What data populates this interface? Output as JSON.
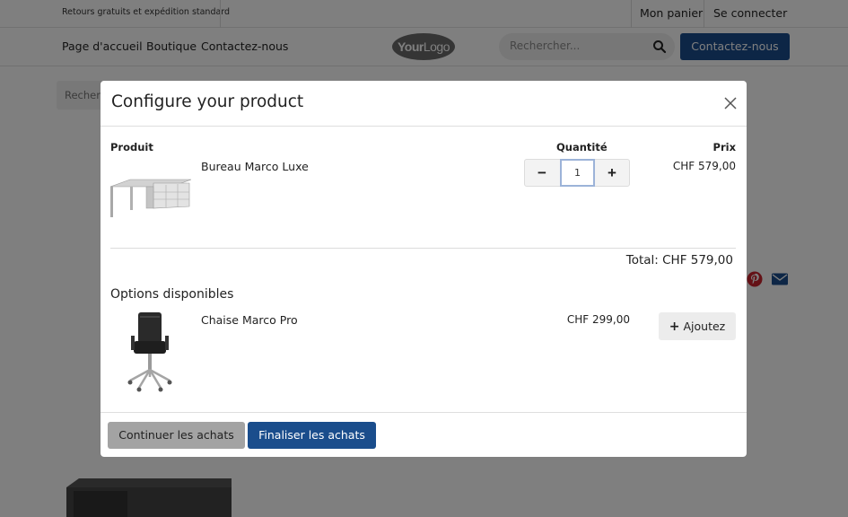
{
  "topbar": {
    "promo": "Retours gratuits et expédition standard",
    "cart": "Mon panier",
    "login": "Se connecter"
  },
  "nav": {
    "items": [
      "Page d'accueil",
      "Boutique",
      "Contactez-nous"
    ],
    "logo": {
      "bold": "Your",
      "light": "Logo"
    },
    "search_placeholder": "Rechercher...",
    "contact_button": "Contactez-nous"
  },
  "background": {
    "breadcrumb": "Rechercher"
  },
  "modal": {
    "title": "Configure your product",
    "columns": {
      "product": "Produit",
      "quantity": "Quantité",
      "price": "Prix"
    },
    "product": {
      "name": "Bureau Marco Luxe",
      "quantity": "1",
      "price": "CHF 579,00"
    },
    "total": "Total: CHF 579,00",
    "options_title": "Options disponibles",
    "options": [
      {
        "name": "Chaise Marco Pro",
        "price": "CHF 299,00",
        "add_label": "Ajoutez"
      }
    ],
    "footer": {
      "continue": "Continuer les achats",
      "checkout": "Finaliser les achats"
    }
  },
  "colors": {
    "primary": "#1a4d8c",
    "overlay": "rgba(0,0,0,0.5)",
    "pinterest": "#c8232c",
    "email_icon": "#1a4d8c"
  }
}
